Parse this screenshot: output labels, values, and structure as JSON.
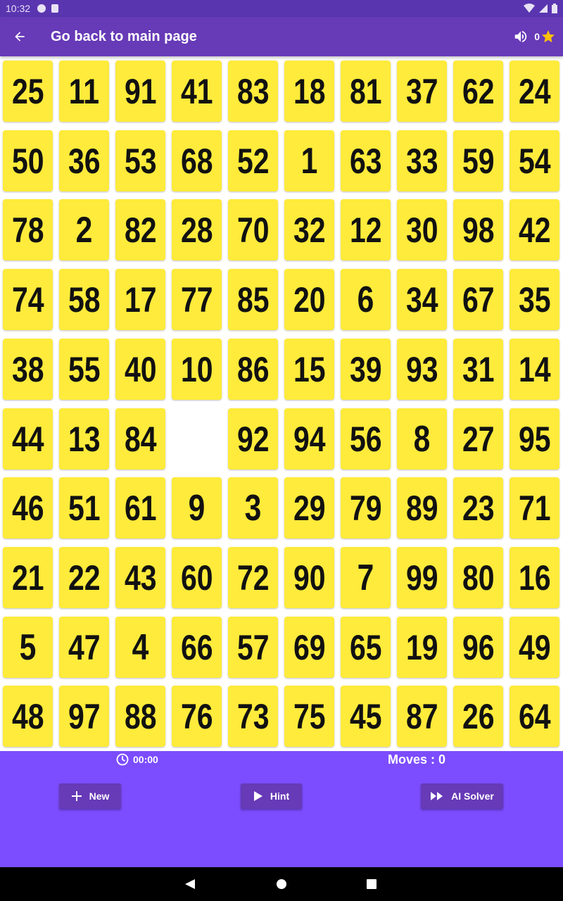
{
  "status_bar": {
    "time": "10:32"
  },
  "app_bar": {
    "title": "Go back to main page",
    "score": "0"
  },
  "board": {
    "rows": [
      [
        "25",
        "11",
        "91",
        "41",
        "83",
        "18",
        "81",
        "37",
        "62",
        "24"
      ],
      [
        "50",
        "36",
        "53",
        "68",
        "52",
        "1",
        "63",
        "33",
        "59",
        "54"
      ],
      [
        "78",
        "2",
        "82",
        "28",
        "70",
        "32",
        "12",
        "30",
        "98",
        "42"
      ],
      [
        "74",
        "58",
        "17",
        "77",
        "85",
        "20",
        "6",
        "34",
        "67",
        "35"
      ],
      [
        "38",
        "55",
        "40",
        "10",
        "86",
        "15",
        "39",
        "93",
        "31",
        "14"
      ],
      [
        "44",
        "13",
        "84",
        "",
        "92",
        "94",
        "56",
        "8",
        "27",
        "95"
      ],
      [
        "46",
        "51",
        "61",
        "9",
        "3",
        "29",
        "79",
        "89",
        "23",
        "71"
      ],
      [
        "21",
        "22",
        "43",
        "60",
        "72",
        "90",
        "7",
        "99",
        "80",
        "16"
      ],
      [
        "5",
        "47",
        "4",
        "66",
        "57",
        "69",
        "65",
        "19",
        "96",
        "49"
      ],
      [
        "48",
        "97",
        "88",
        "76",
        "73",
        "75",
        "45",
        "87",
        "26",
        "64"
      ]
    ]
  },
  "bottom": {
    "timer": "00:00",
    "moves": "Moves : 0",
    "new_label": "New",
    "hint_label": "Hint",
    "solver_label": "AI Solver"
  },
  "colors": {
    "app_bar": "#673ab7",
    "status_bar": "#5a35b0",
    "bottom_panel": "#7c4dff",
    "tile": "#ffeb3b",
    "star": "#ffc107"
  }
}
